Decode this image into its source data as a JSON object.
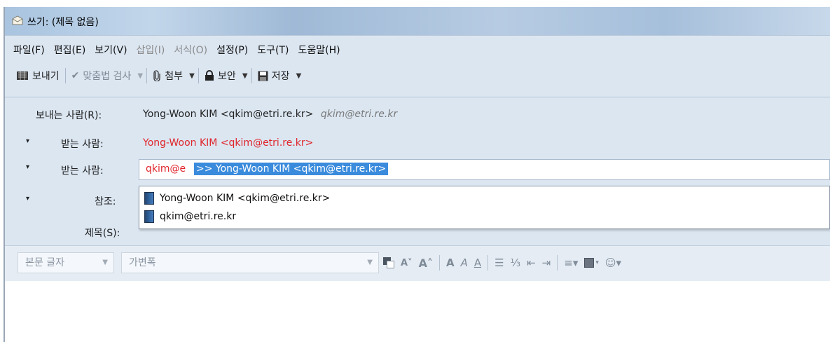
{
  "window": {
    "title": "쓰기: (제목 없음)"
  },
  "menu": [
    {
      "label": "파일(F)",
      "enabled": true
    },
    {
      "label": "편집(E)",
      "enabled": true
    },
    {
      "label": "보기(V)",
      "enabled": true
    },
    {
      "label": "삽입(I)",
      "enabled": false
    },
    {
      "label": "서식(O)",
      "enabled": false
    },
    {
      "label": "설정(P)",
      "enabled": true
    },
    {
      "label": "도구(T)",
      "enabled": true
    },
    {
      "label": "도움말(H)",
      "enabled": true
    }
  ],
  "toolbar": {
    "send": "보내기",
    "spell": "맞춤법 검사",
    "attach": "첨부",
    "security": "보안",
    "save": "저장"
  },
  "headers": {
    "from_label": "보내는 사람(R):",
    "from_value": "Yong-Woon KIM <qkim@etri.re.kr>",
    "from_alias": "qkim@etri.re.kr",
    "to_label": "받는 사람:",
    "to1_value": "Yong-Woon KIM <qkim@etri.re.kr>",
    "to2_typed": "qkim@e",
    "to2_completion": ">> Yong-Woon KIM <qkim@etri.re.kr>",
    "cc_label": "참조:",
    "subject_label": "제목(S):"
  },
  "autocomplete": [
    "Yong-Woon KIM <qkim@etri.re.kr>",
    "qkim@etri.re.kr"
  ],
  "format": {
    "paragraph": "본문 글자",
    "font": "가변폭"
  },
  "colors": {
    "accent_selection": "#3a8bdc",
    "recipient_red": "#e0252b",
    "header_bg": "#dbe6f1"
  }
}
